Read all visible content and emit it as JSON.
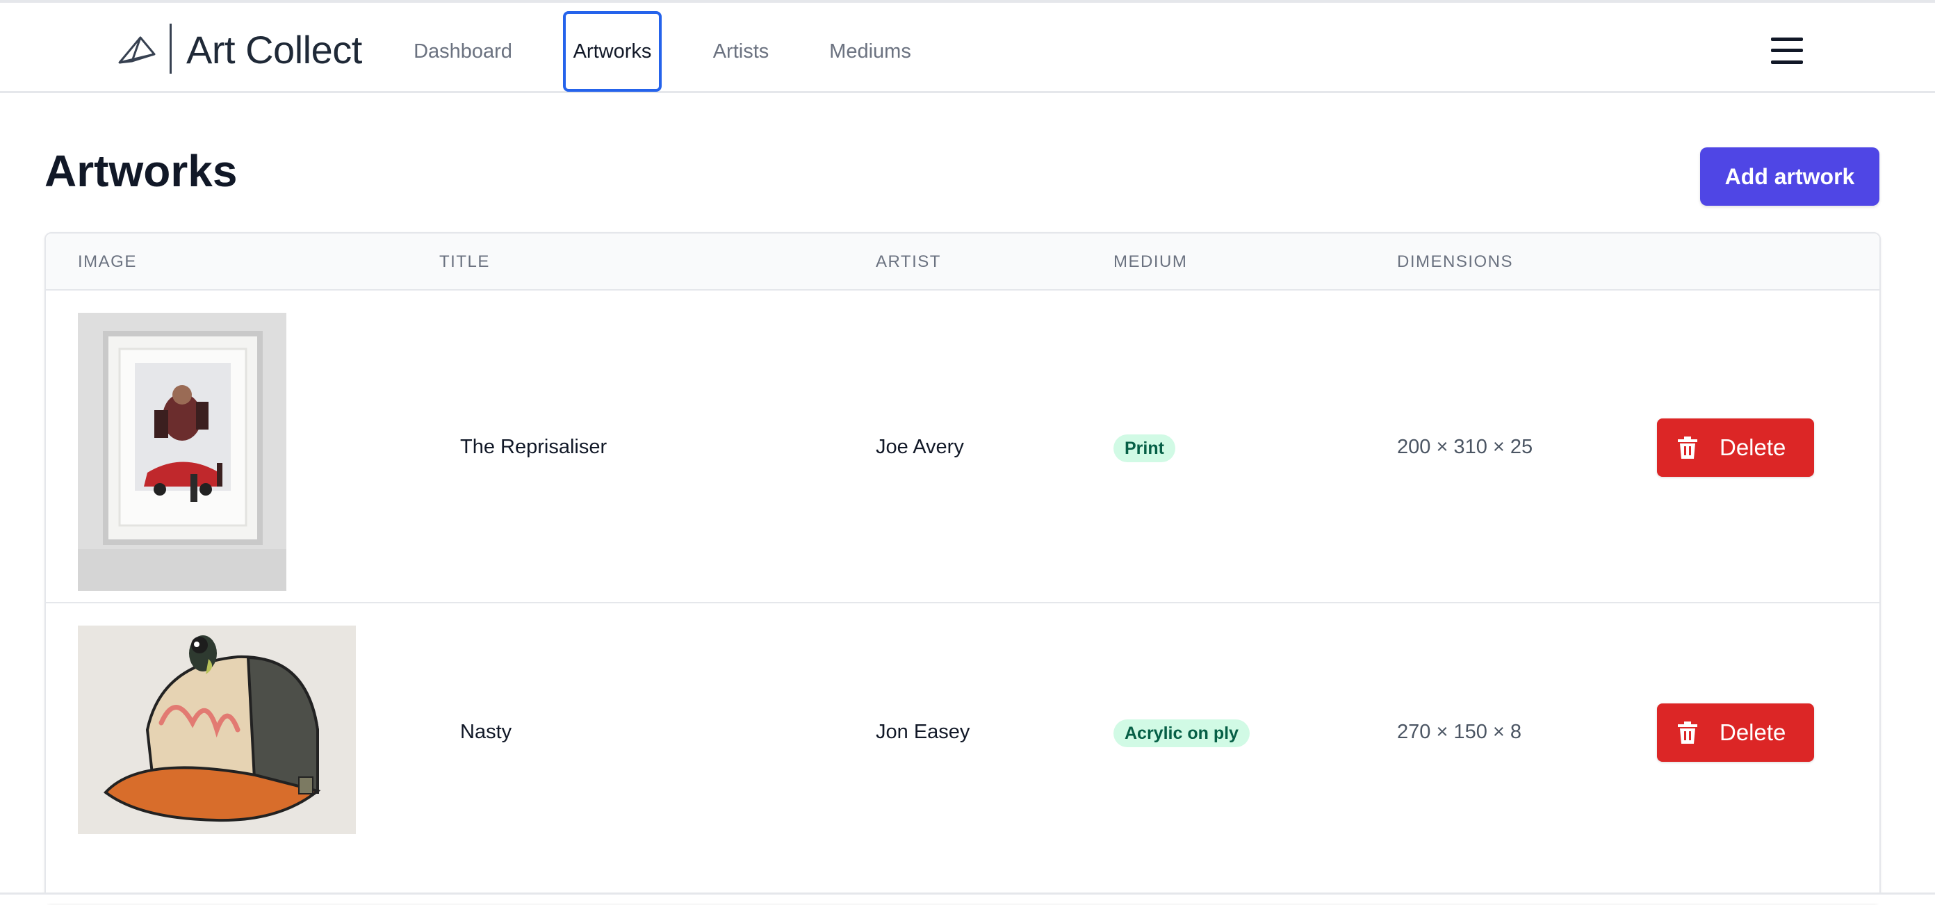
{
  "app": {
    "name": "Art Collect",
    "logo_icon": "prism-outline-icon"
  },
  "nav": {
    "items": [
      {
        "label": "Dashboard",
        "active": false
      },
      {
        "label": "Artworks",
        "active": true
      },
      {
        "label": "Artists",
        "active": false
      },
      {
        "label": "Mediums",
        "active": false
      }
    ],
    "menu_icon": "hamburger-menu-icon"
  },
  "page": {
    "title": "Artworks",
    "add_button": "Add artwork"
  },
  "table": {
    "headers": {
      "image": "IMAGE",
      "title": "TITLE",
      "artist": "ARTIST",
      "medium": "MEDIUM",
      "dimensions": "DIMENSIONS"
    },
    "rows": [
      {
        "image_icon": "framed-artwork-thumbnail",
        "title": "The Reprisaliser",
        "artist": "Joe Avery",
        "medium": "Print",
        "dimensions": "200 × 310 × 25",
        "delete_label": "Delete"
      },
      {
        "image_icon": "cap-with-bird-thumbnail",
        "title": "Nasty",
        "artist": "Jon Easey",
        "medium": "Acrylic on ply",
        "dimensions": "270 × 150 × 8",
        "delete_label": "Delete"
      }
    ]
  },
  "colors": {
    "primary": "#4f46e5",
    "danger": "#dc2626",
    "badge_bg": "#d1fae5",
    "badge_text": "#065f46",
    "active_outline": "#2563eb"
  }
}
